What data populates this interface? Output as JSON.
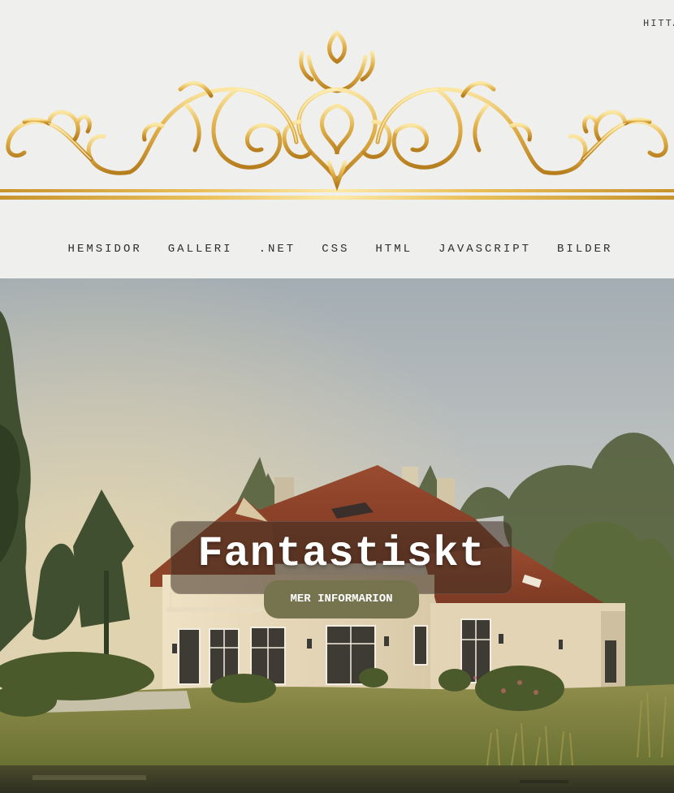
{
  "header": {
    "top_link_label": "HITTA",
    "ornament": "gold-baroque-scroll-ornament"
  },
  "nav": {
    "items": [
      {
        "label": "HEMSIDOR"
      },
      {
        "label": "GALLERI"
      },
      {
        "label": ".NET"
      },
      {
        "label": "CSS"
      },
      {
        "label": "HTML"
      },
      {
        "label": "JAVASCRIPT"
      },
      {
        "label": "BILDER"
      }
    ]
  },
  "hero": {
    "image": "villa-with-red-tile-roof-by-lake",
    "title": "Fantastiskt",
    "button_label": "MER INFORMARION"
  },
  "colors": {
    "background": "#efefed",
    "gold": "#d9a93c",
    "button": "#76734f",
    "text": "#2c2c2c"
  }
}
